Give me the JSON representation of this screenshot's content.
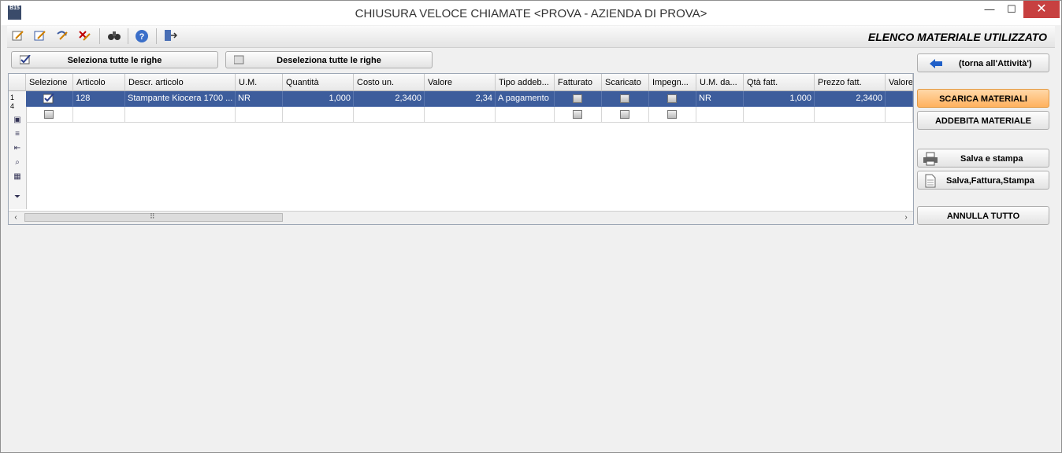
{
  "window": {
    "app_badge": "B15",
    "title": "CHIUSURA VELOCE CHIAMATE <PROVA - AZIENDA DI PROVA>",
    "minimize": "—",
    "maximize": "☐",
    "close": "✕"
  },
  "toolbar": {
    "icons": [
      "new-record-icon",
      "edit-record-icon",
      "undo-icon",
      "delete-icon",
      "binoculars-icon",
      "help-icon",
      "exit-icon"
    ],
    "section_title": "ELENCO MATERIALE UTILIZZATO"
  },
  "actions": {
    "select_all": "Seleziona tutte le righe",
    "deselect_all": "Deseleziona tutte le righe",
    "back": "(torna all'Attività')",
    "scarica": "SCARICA MATERIALI",
    "addebita": "ADDEBITA MATERIALE",
    "salva_stampa": "Salva e stampa",
    "salva_fattura": "Salva,Fattura,Stampa",
    "annulla": "ANNULLA TUTTO"
  },
  "grid": {
    "columns": [
      "Selezione",
      "Articolo",
      "Descr. articolo",
      "U.M.",
      "Quantità",
      "Costo un.",
      "Valore",
      "Tipo addeb...",
      "Fatturato",
      "Scaricato",
      "Impegn...",
      "U.M. da...",
      "Qtà fatt.",
      "Prezzo fatt.",
      "Valore"
    ],
    "row_number": "1",
    "row_count": "4",
    "rows": [
      {
        "selected": true,
        "articolo": "128",
        "descr": "Stampante Kiocera 1700 ...",
        "um": "NR",
        "quantita": "1,000",
        "costo": "2,3400",
        "valore": "2,34",
        "tipo": "A pagamento",
        "um_da": "NR",
        "qta_fatt": "1,000",
        "prezzo_fatt": "2,3400"
      }
    ]
  }
}
